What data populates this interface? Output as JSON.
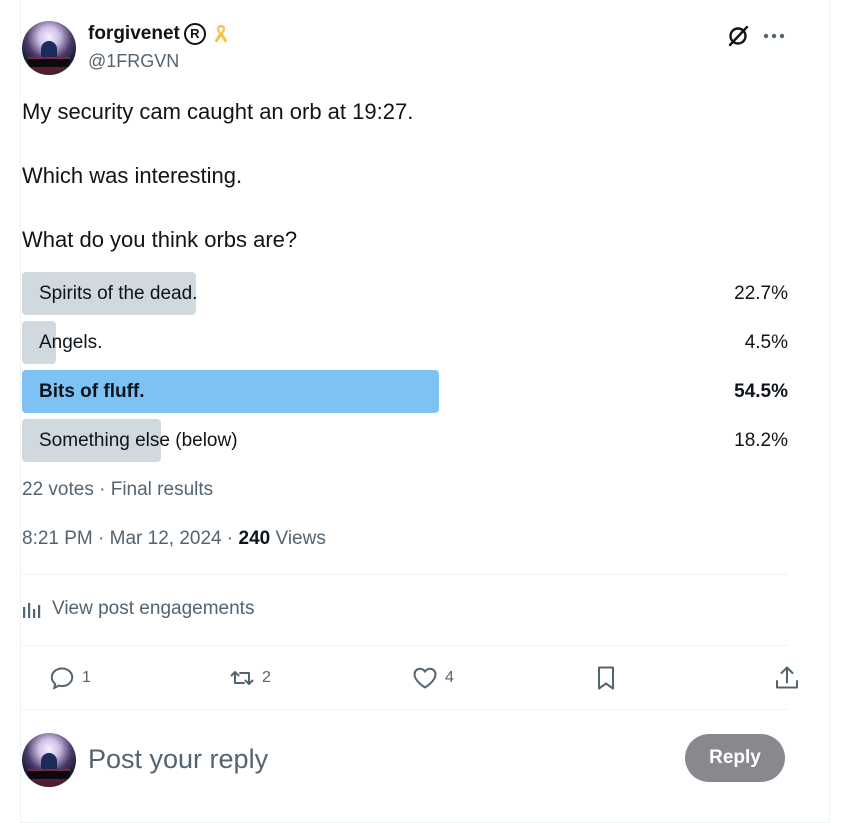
{
  "author": {
    "name": "forgivenet",
    "badge_letter": "R",
    "handle": "@1FRGVN"
  },
  "tweet": {
    "lines": [
      "My security cam caught an orb at 19:27.",
      "Which was interesting.",
      "What do you think orbs are?"
    ]
  },
  "poll": {
    "options": [
      {
        "label": "Spirits of the dead.",
        "percent_text": "22.7%",
        "percent": 22.7,
        "winner": false
      },
      {
        "label": "Angels.",
        "percent_text": "4.5%",
        "percent": 4.5,
        "winner": false
      },
      {
        "label": "Bits of fluff.",
        "percent_text": "54.5%",
        "percent": 54.5,
        "winner": true
      },
      {
        "label": "Something else (below)",
        "percent_text": "18.2%",
        "percent": 18.2,
        "winner": false
      }
    ],
    "votes_text": "22 votes",
    "status_text": "Final results",
    "separator": "·"
  },
  "meta": {
    "time": "8:21 PM",
    "date": "Mar 12, 2024",
    "separator": "·",
    "views_count": "240",
    "views_label": "Views"
  },
  "engagements_label": "View post engagements",
  "actions": {
    "reply_count": "1",
    "repost_count": "2",
    "like_count": "4"
  },
  "reply_box": {
    "placeholder": "Post your reply",
    "button_label": "Reply"
  },
  "colors": {
    "winner_bar": "#7dc1f5",
    "loser_bar": "#cfd9de",
    "muted_text": "#536471",
    "reply_button": "#87898c",
    "ribbon": "#f7c34a"
  }
}
